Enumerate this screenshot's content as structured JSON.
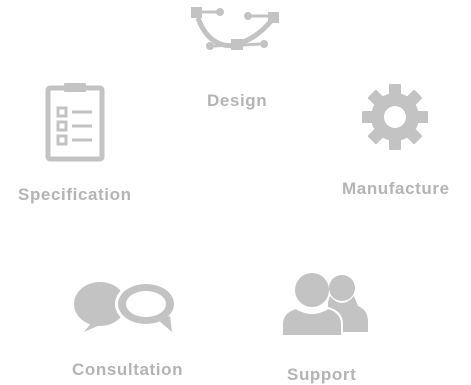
{
  "colors": {
    "icon": "#c3c3c3",
    "label": "#b4b4b4",
    "background": "#ffffff"
  },
  "steps": [
    {
      "label": "Design",
      "icon": "bezier-curve-icon"
    },
    {
      "label": "Specification",
      "icon": "clipboard-checklist-icon"
    },
    {
      "label": "Manufacture",
      "icon": "gear-icon"
    },
    {
      "label": "Consultation",
      "icon": "speech-bubbles-icon"
    },
    {
      "label": "Support",
      "icon": "users-icon"
    }
  ]
}
